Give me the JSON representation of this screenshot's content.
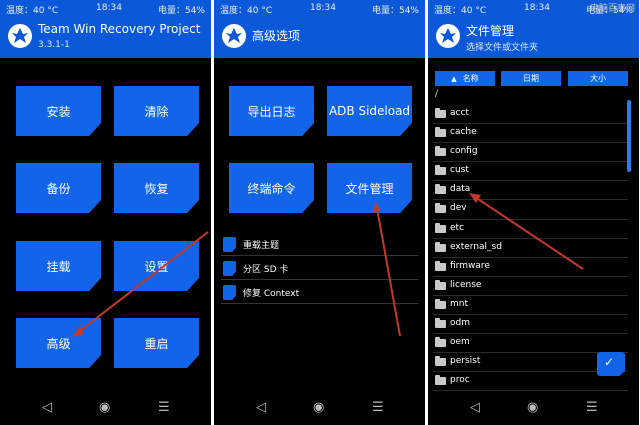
{
  "status": {
    "temp": "温度：40 °C",
    "time": "18:34",
    "battery": "电量：54%"
  },
  "panel1": {
    "title": "Team Win Recovery Project",
    "version": "3.3.1-1",
    "tiles": [
      "安装",
      "清除",
      "备份",
      "恢复",
      "挂载",
      "设置",
      "高级",
      "重启"
    ]
  },
  "panel2": {
    "title": "高级选项",
    "tiles": [
      "导出日志",
      "ADB Sideload",
      "终端命令",
      "文件管理"
    ],
    "options": [
      "重载主题",
      "分区 SD 卡",
      "修复 Context"
    ]
  },
  "panel3": {
    "title": "文件管理",
    "subtitle": "选择文件或文件夹",
    "sort": {
      "name": "名称",
      "date": "日期",
      "size": "大小"
    },
    "path": "/",
    "files": [
      "acct",
      "cache",
      "config",
      "cust",
      "data",
      "dev",
      "etc",
      "external_sd",
      "firmware",
      "license",
      "mnt",
      "odm",
      "oem",
      "persist",
      "proc"
    ],
    "watermark": "电脑百事网"
  },
  "nav": {
    "back": "◁",
    "home": "◉",
    "menu": "☰"
  },
  "icons": {
    "logo": "twrp-logo-icon",
    "select": "check-folder-icon",
    "sort_up": "sort-ascending-icon"
  },
  "colors": {
    "accent": "#1264e8",
    "header": "#0b59d9",
    "background": "#000000",
    "arrow": "#c0392b"
  }
}
